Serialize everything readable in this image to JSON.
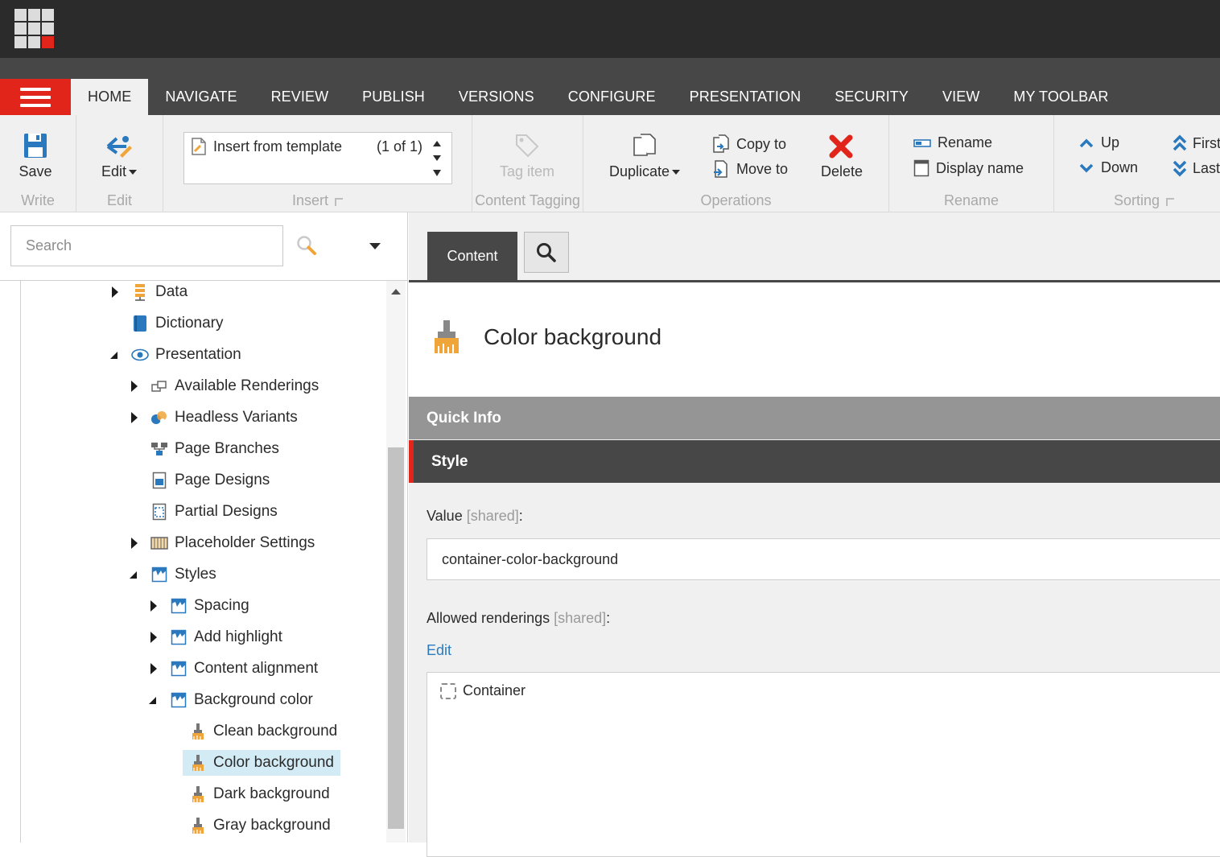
{
  "topbar": {
    "logo": "sitecore-logo"
  },
  "nav": {
    "menu_icon": "hamburger-icon",
    "tabs": [
      "HOME",
      "NAVIGATE",
      "REVIEW",
      "PUBLISH",
      "VERSIONS",
      "CONFIGURE",
      "PRESENTATION",
      "SECURITY",
      "VIEW",
      "MY TOOLBAR"
    ],
    "active_tab": "HOME"
  },
  "ribbon": {
    "write": {
      "label": "Write",
      "save": "Save"
    },
    "edit": {
      "label": "Edit",
      "edit": "Edit"
    },
    "insert": {
      "label": "Insert",
      "item": "Insert from template",
      "count": "(1 of 1)"
    },
    "tagging": {
      "label": "Content Tagging",
      "tag": "Tag item"
    },
    "operations": {
      "label": "Operations",
      "duplicate": "Duplicate",
      "copy_to": "Copy to",
      "move_to": "Move to",
      "delete": "Delete"
    },
    "rename": {
      "label": "Rename",
      "rename": "Rename",
      "display_name": "Display name"
    },
    "sorting": {
      "label": "Sorting",
      "up": "Up",
      "down": "Down",
      "first": "First",
      "last": "Last"
    }
  },
  "search": {
    "placeholder": "Search"
  },
  "tree": {
    "data": "Data",
    "dictionary": "Dictionary",
    "presentation": "Presentation",
    "available_renderings": "Available Renderings",
    "headless_variants": "Headless Variants",
    "page_branches": "Page Branches",
    "page_designs": "Page Designs",
    "partial_designs": "Partial Designs",
    "placeholder_settings": "Placeholder Settings",
    "styles": "Styles",
    "spacing": "Spacing",
    "add_highlight": "Add highlight",
    "content_alignment": "Content alignment",
    "background_color": "Background color",
    "clean_background": "Clean background",
    "color_background": "Color background",
    "dark_background": "Dark background",
    "gray_background": "Gray background"
  },
  "editor": {
    "content_tab": "Content",
    "item_title": "Color background",
    "quick_info": "Quick Info",
    "section": "Style",
    "value_label": "Value",
    "shared_tag": "[shared]",
    "colon": ":",
    "value": "container-color-background",
    "allowed_label": "Allowed renderings",
    "edit_link": "Edit",
    "allowed_items": [
      "Container"
    ]
  },
  "colors": {
    "accent": "#e1251b",
    "dark": "#2b2b2b",
    "tabbar": "#474747",
    "ribbon": "#f0f0f0",
    "link": "#2a7bc0",
    "selected": "#d2ebf5"
  }
}
